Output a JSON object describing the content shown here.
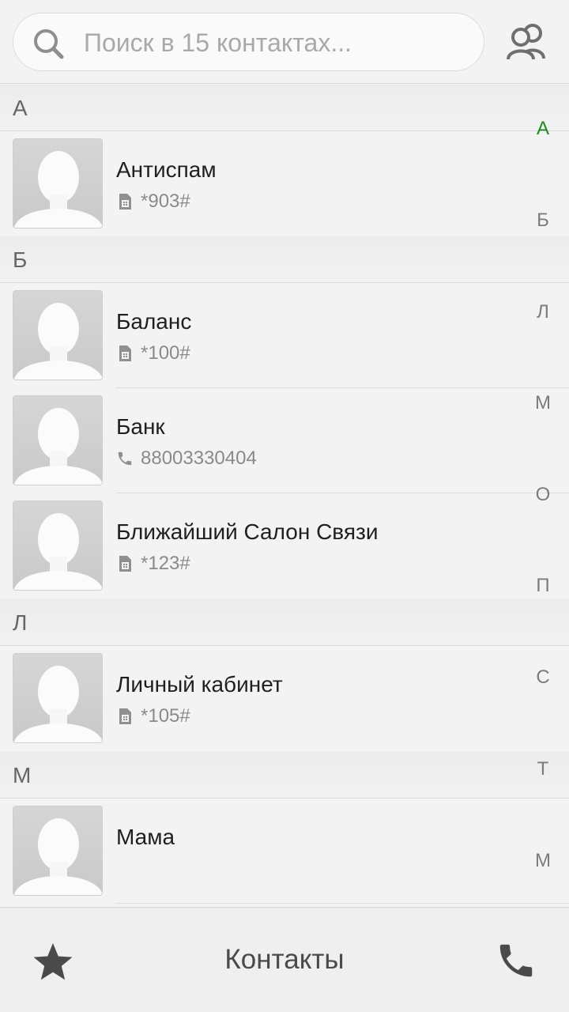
{
  "search": {
    "placeholder": "Поиск в 15 контактах..."
  },
  "sections": [
    {
      "letter": "А",
      "contacts": [
        {
          "name": "Антиспам",
          "detail": "*903#",
          "detail_icon": "sim-card-icon"
        }
      ]
    },
    {
      "letter": "Б",
      "contacts": [
        {
          "name": "Баланс",
          "detail": "*100#",
          "detail_icon": "sim-card-icon"
        },
        {
          "name": "Банк",
          "detail": "88003330404",
          "detail_icon": "phone-icon"
        },
        {
          "name": "Ближайший Салон Связи",
          "detail": "*123#",
          "detail_icon": "sim-card-icon"
        }
      ]
    },
    {
      "letter": "Л",
      "contacts": [
        {
          "name": "Личный кабинет",
          "detail": "*105#",
          "detail_icon": "sim-card-icon"
        }
      ]
    },
    {
      "letter": "М",
      "contacts": [
        {
          "name": "Мама",
          "detail": "",
          "detail_icon": ""
        }
      ]
    }
  ],
  "index": [
    "А",
    "Б",
    "Л",
    "М",
    "О",
    "П",
    "С",
    "Т",
    "М"
  ],
  "index_active": "А",
  "bottom": {
    "title": "Контакты"
  },
  "colors": {
    "accent_active_index": "#1e8a1e",
    "background": "#f3f3f3"
  }
}
